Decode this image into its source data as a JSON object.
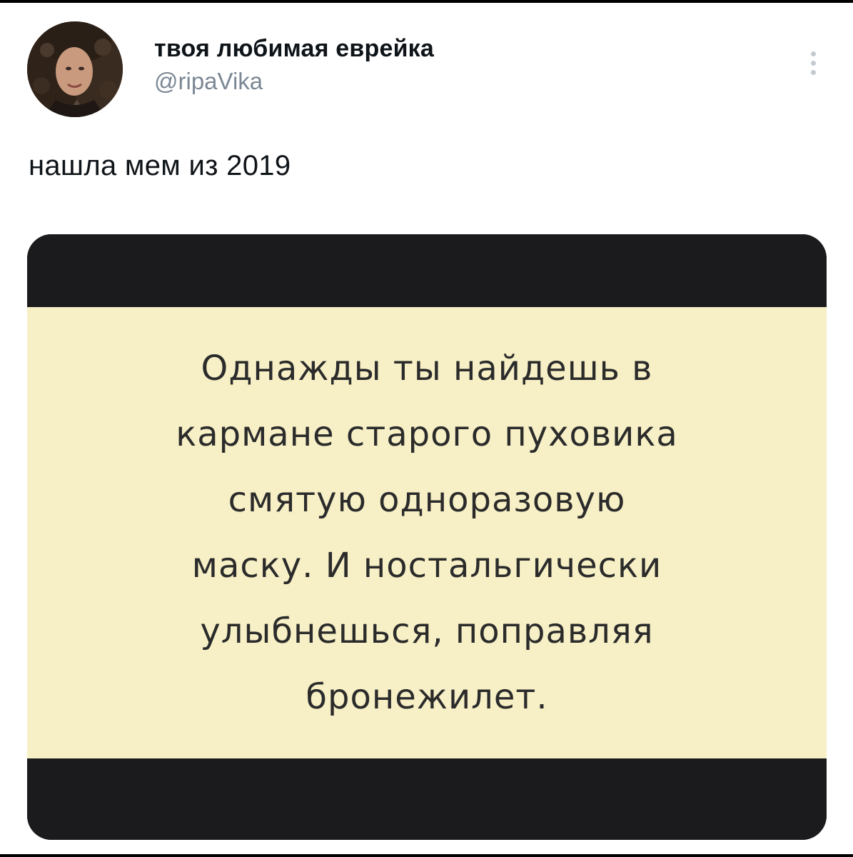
{
  "tweet": {
    "author": {
      "display_name": "твоя любимая еврейка",
      "handle": "@ripaVika"
    },
    "text": "нашла мем из 2019",
    "media": {
      "meme_lines": [
        "Однажды ты найдешь в",
        "кармане старого пуховика",
        "смятую одноразовую",
        "маску. И ностальгически",
        "улыбнешься, поправляя",
        "бронежилет."
      ],
      "colors": {
        "card_background": "#f7f0c6",
        "bars": "#1b1b1d",
        "text": "#2b2b2b"
      }
    },
    "icons": {
      "more": "more-vertical-icon"
    }
  }
}
